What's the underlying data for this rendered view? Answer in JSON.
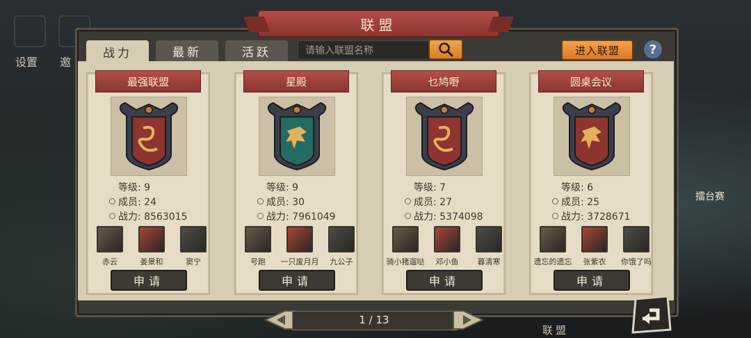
{
  "background": {
    "settings_label": "设置",
    "partial_label": "邀",
    "right_label": "擂台赛",
    "bottom_label": "联盟"
  },
  "title": "联盟",
  "tabs": [
    {
      "label": "战力",
      "active": true
    },
    {
      "label": "最新",
      "active": false
    },
    {
      "label": "活跃",
      "active": false
    }
  ],
  "search": {
    "placeholder": "请输入联盟名称",
    "icon": "search-icon"
  },
  "enter_button": "进入联盟",
  "help_button": "?",
  "stat_labels": {
    "level": "等级:",
    "members": "成员:",
    "power": "战力:"
  },
  "alliances": [
    {
      "name": "最强联盟",
      "emblem_color": "#8d3530",
      "emblem": "serpent",
      "level": "9",
      "members": "24",
      "power": "8563015",
      "members_list": [
        "赤云",
        "姜景和",
        "窦宁"
      ],
      "apply": "申请"
    },
    {
      "name": "星殿",
      "emblem_color": "#236b63",
      "emblem": "dragon",
      "level": "9",
      "members": "30",
      "power": "7961049",
      "members_list": [
        "号跑",
        "一只废月月",
        "九公子"
      ],
      "apply": "申请"
    },
    {
      "name": "乜鸠嘢",
      "emblem_color": "#8d3530",
      "emblem": "serpent",
      "level": "7",
      "members": "27",
      "power": "5374098",
      "members_list": [
        "骑小猪遛哒",
        "邓小鱼",
        "暮清寒"
      ],
      "apply": "申请"
    },
    {
      "name": "圆桌会议",
      "emblem_color": "#8d3530",
      "emblem": "dragon",
      "level": "6",
      "members": "25",
      "power": "3728671",
      "members_list": [
        "遗忘的遗忘",
        "张紫衣",
        "你饿了吗"
      ],
      "apply": "申请"
    }
  ],
  "pager": {
    "text": "1 / 13"
  }
}
